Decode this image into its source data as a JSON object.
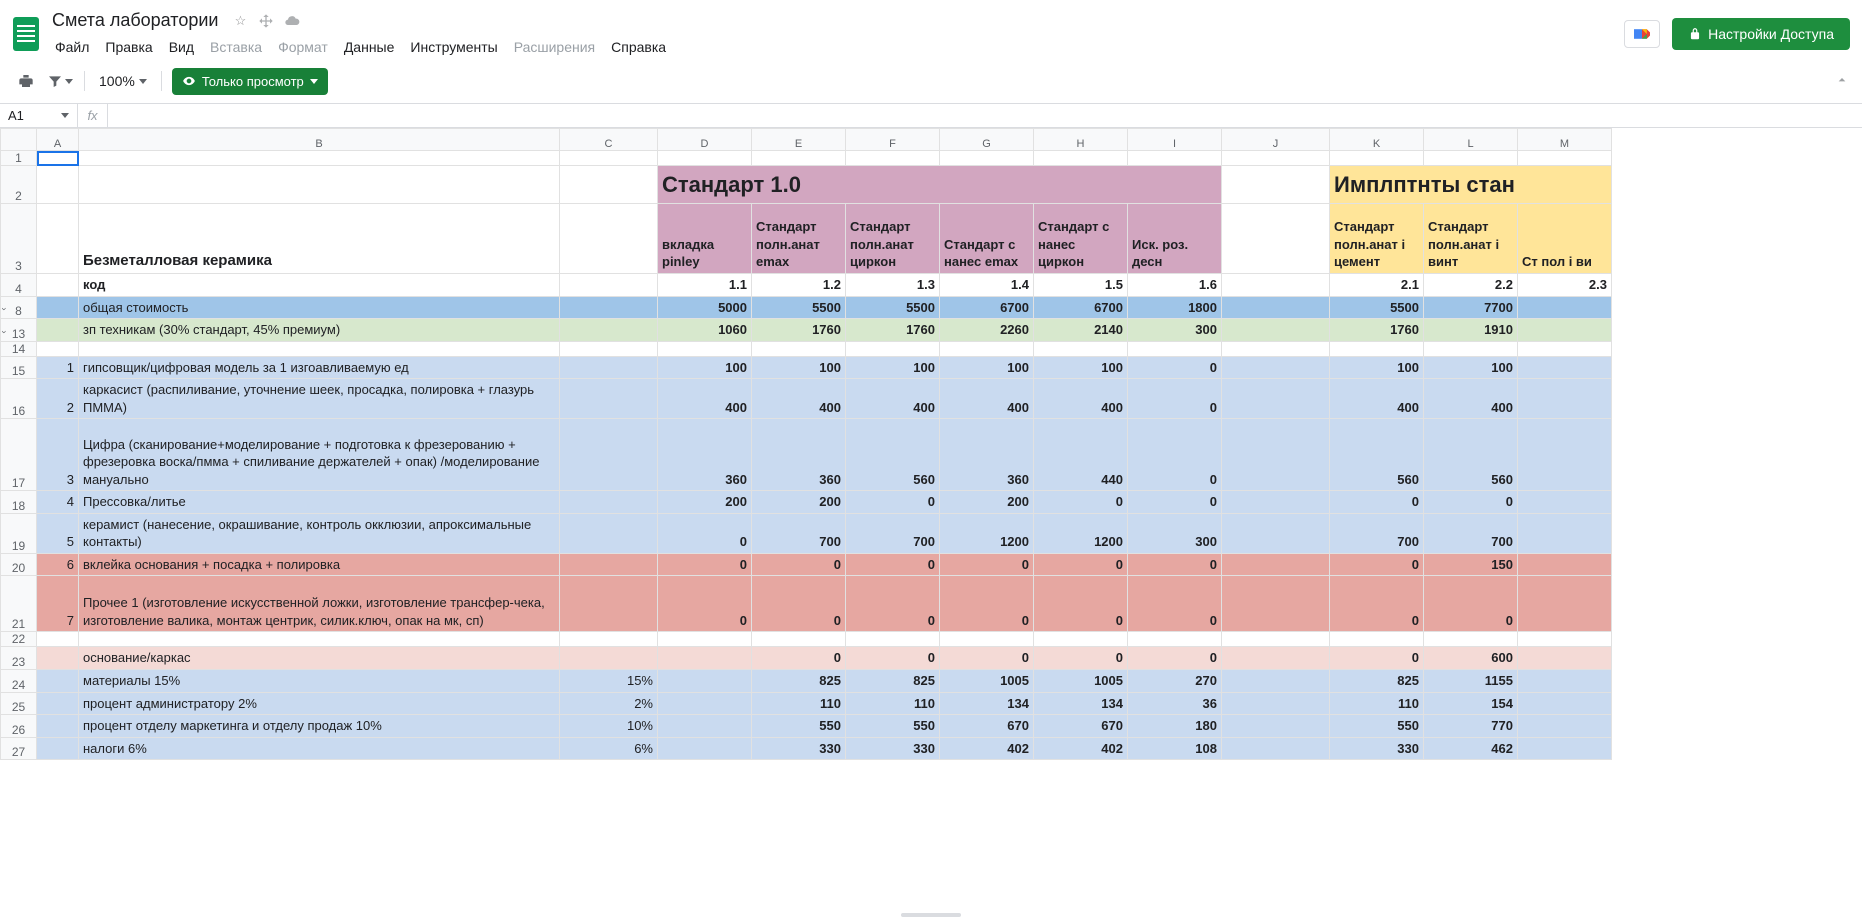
{
  "header": {
    "doc_title": "Смета лаборатории",
    "menus": [
      "Файл",
      "Правка",
      "Вид",
      "Вставка",
      "Формат",
      "Данные",
      "Инструменты",
      "Расширения",
      "Справка"
    ],
    "menus_disabled": [
      "Вставка",
      "Формат",
      "Расширения"
    ],
    "share_label": "Настройки Доступа"
  },
  "toolbar": {
    "zoom": "100%",
    "view_only": "Только просмотр"
  },
  "namebox": "A1",
  "columns": [
    "A",
    "B",
    "C",
    "D",
    "E",
    "F",
    "G",
    "H",
    "I",
    "J",
    "K",
    "L",
    "M"
  ],
  "row_labels": [
    "1",
    "2",
    "3",
    "4",
    "8",
    "13",
    "14",
    "15",
    "16",
    "17",
    "18",
    "19",
    "20",
    "21",
    "22",
    "23",
    "24",
    "25",
    "26",
    "27"
  ],
  "foldable_rows": [
    "8",
    "13"
  ],
  "big_headers": {
    "standard": "Стандарт 1.0",
    "implants": "Имплптнты стан"
  },
  "col_headers": {
    "D": "вкладка pinley",
    "E": "Стандарт полн.анат emax",
    "F": "Стандарт полн.анат циркон",
    "G": "Стандарт с нанес emax",
    "H": "Стандарт с нанес циркон",
    "I": "Иск. роз. десн",
    "K": "Стандарт полн.анат i цемент",
    "L": "Стандарт полн.анат i винт",
    "M": "Ст пол i ви"
  },
  "rows": {
    "r3B": "Безметалловая керамика",
    "r4": {
      "B": "код",
      "D": "1.1",
      "E": "1.2",
      "F": "1.3",
      "G": "1.4",
      "H": "1.5",
      "I": "1.6",
      "K": "2.1",
      "L": "2.2",
      "M": "2.3"
    },
    "r8": {
      "B": "общая стоимость",
      "D": "5000",
      "E": "5500",
      "F": "5500",
      "G": "6700",
      "H": "6700",
      "I": "1800",
      "K": "5500",
      "L": "7700"
    },
    "r13": {
      "B": "зп техникам (30% стандарт, 45% премиум)",
      "D": "1060",
      "E": "1760",
      "F": "1760",
      "G": "2260",
      "H": "2140",
      "I": "300",
      "K": "1760",
      "L": "1910"
    },
    "r15": {
      "A": "1",
      "B": "гипсовщик/цифровая модель за 1 изгоавливаемую ед",
      "D": "100",
      "E": "100",
      "F": "100",
      "G": "100",
      "H": "100",
      "I": "0",
      "K": "100",
      "L": "100"
    },
    "r16": {
      "A": "2",
      "B": "каркасист (распиливание, уточнение шеек, просадка, полировка + глазурь ПММА)",
      "D": "400",
      "E": "400",
      "F": "400",
      "G": "400",
      "H": "400",
      "I": "0",
      "K": "400",
      "L": "400"
    },
    "r17": {
      "A": "3",
      "B": "Цифра (сканирование+моделирование + подготовка к фрезерованию + фрезеровка воска/пмма + спиливание держателей + опак) /моделирование мануально",
      "D": "360",
      "E": "360",
      "F": "560",
      "G": "360",
      "H": "440",
      "I": "0",
      "K": "560",
      "L": "560"
    },
    "r18": {
      "A": "4",
      "B": "Прессовка/литье",
      "D": "200",
      "E": "200",
      "F": "0",
      "G": "200",
      "H": "0",
      "I": "0",
      "K": "0",
      "L": "0"
    },
    "r19": {
      "A": "5",
      "B": "керамист (нанесение, окрашивание, контроль окклюзии, апроксимальные контакты)",
      "D": "0",
      "E": "700",
      "F": "700",
      "G": "1200",
      "H": "1200",
      "I": "300",
      "K": "700",
      "L": "700"
    },
    "r20": {
      "A": "6",
      "B": "вклейка основания + посадка + полировка",
      "D": "0",
      "E": "0",
      "F": "0",
      "G": "0",
      "H": "0",
      "I": "0",
      "K": "0",
      "L": "150"
    },
    "r21": {
      "A": "7",
      "B": "Прочее 1 (изготовление  искусственной ложки, изготовление трансфер-чека, изготовление валика, монтаж центрик, силик.ключ, опак на мк, сп)",
      "D": "0",
      "E": "0",
      "F": "0",
      "G": "0",
      "H": "0",
      "I": "0",
      "K": "0",
      "L": "0"
    },
    "r23": {
      "B": "основание/каркас",
      "E": "0",
      "F": "0",
      "G": "0",
      "H": "0",
      "I": "0",
      "K": "0",
      "L": "600"
    },
    "r24": {
      "B": "материалы 15%",
      "C": "15%",
      "E": "825",
      "F": "825",
      "G": "1005",
      "H": "1005",
      "I": "270",
      "K": "825",
      "L": "1155"
    },
    "r25": {
      "B": "процент администратору 2%",
      "C": "2%",
      "E": "110",
      "F": "110",
      "G": "134",
      "H": "134",
      "I": "36",
      "K": "110",
      "L": "154"
    },
    "r26": {
      "B": "процент отделу маркетинга и отделу продаж 10%",
      "C": "10%",
      "E": "550",
      "F": "550",
      "G": "670",
      "H": "670",
      "I": "180",
      "K": "550",
      "L": "770"
    },
    "r27": {
      "B": "налоги 6%",
      "C": "6%",
      "E": "330",
      "F": "330",
      "G": "402",
      "H": "402",
      "I": "108",
      "K": "330",
      "L": "462"
    }
  },
  "chart_data": {
    "type": "table",
    "note": "Spreadsheet cost estimate; numeric values captured in rows object above."
  }
}
